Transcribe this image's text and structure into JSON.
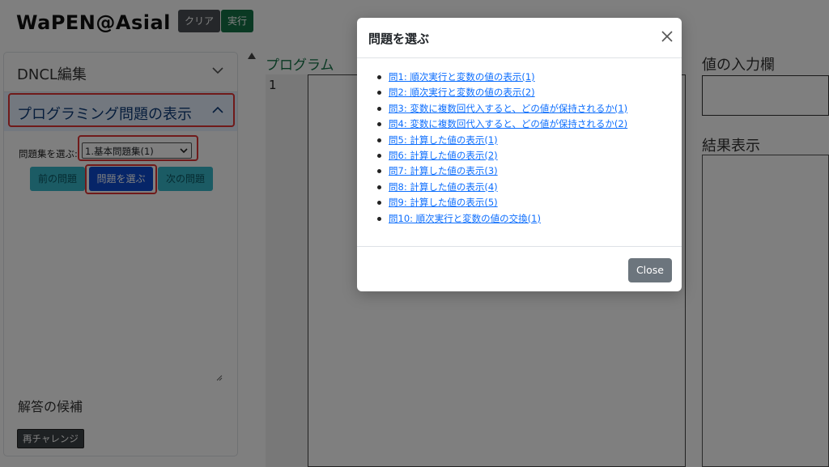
{
  "app": {
    "title": "WaPEN@Asial"
  },
  "toolbar": {
    "clear_label": "クリア",
    "run_label": "実行"
  },
  "left_panel": {
    "dncl_header": "DNCL編集",
    "problem_header": "プログラミング問題の表示",
    "set_label": "問題集を選ぶ:",
    "set_selected": "1.基本問題集(1)",
    "prev_label": "前の問題",
    "choose_label": "問題を選ぶ",
    "next_label": "次の問題",
    "answers_header": "解答の候補",
    "retry_label": "再チャレンジ"
  },
  "program": {
    "header": "プログラム",
    "line_number": "1"
  },
  "right": {
    "input_header": "値の入力欄",
    "result_header": "結果表示"
  },
  "modal": {
    "title": "問題を選ぶ",
    "items": [
      "問1: 順次実行と変数の値の表示(1)",
      "問2: 順次実行と変数の値の表示(2)",
      "問3: 変数に複数回代入すると、どの値が保持されるか(1)",
      "問4: 変数に複数回代入すると、どの値が保持されるか(2)",
      "問5: 計算した値の表示(1)",
      "問6: 計算した値の表示(2)",
      "問7: 計算した値の表示(3)",
      "問8: 計算した値の表示(4)",
      "問9: 計算した値の表示(5)",
      "問10: 順次実行と変数の値の交換(1)"
    ],
    "close_label": "Close"
  },
  "colors": {
    "run_button": "#157347",
    "choose_button": "#0d4bd0",
    "nav_button": "#36b6c9",
    "highlight": "#e03434",
    "link": "#0d6efd"
  }
}
